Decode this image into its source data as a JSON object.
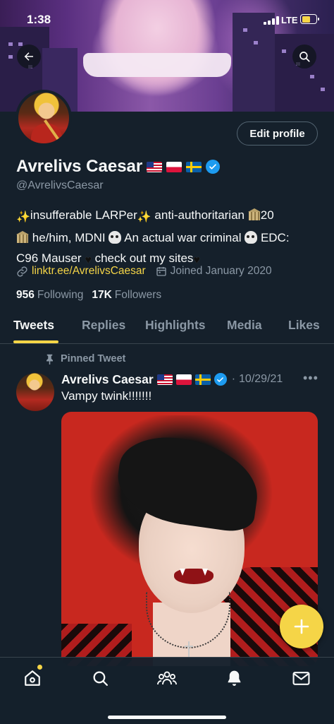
{
  "status_bar": {
    "time": "1:38",
    "network": "LTE"
  },
  "header": {
    "back_icon": "arrow-left-icon",
    "search_icon": "search-icon"
  },
  "profile": {
    "edit_button_label": "Edit profile",
    "display_name": "Avrelivs Caesar",
    "flags": [
      "us-flag",
      "poland-flag",
      "sweden-flag"
    ],
    "verified": true,
    "handle": "@AvrelivsCaesar",
    "bio": {
      "line1_text1": "insufferable LARPer",
      "line1_text2": "anti-authoritarian",
      "line1_text3": "20",
      "line2_text1": "he/him, MDNI",
      "line2_text2": "An actual war criminal",
      "line2_text3": "EDC:",
      "line3_text1": "C96 Mauser",
      "line3_text2": "check out my sites"
    },
    "link": "linktr.ee/AvrelivsCaesar",
    "joined": "Joined January 2020",
    "following_count": "956",
    "following_label": "Following",
    "followers_count": "17K",
    "followers_label": "Followers"
  },
  "tabs": [
    {
      "label": "Tweets",
      "active": true
    },
    {
      "label": "Replies",
      "active": false
    },
    {
      "label": "Highlights",
      "active": false
    },
    {
      "label": "Media",
      "active": false
    },
    {
      "label": "Likes",
      "active": false
    }
  ],
  "pinned_tweet": {
    "pinned_label": "Pinned Tweet",
    "author_name": "Avrelivs Caesar",
    "date": "10/29/21",
    "more_icon": "more-horizontal-icon",
    "text": "Vampy twink!!!!!!!",
    "media": "photo"
  },
  "fab": {
    "icon": "plus-icon"
  },
  "bottom_nav": {
    "items": [
      "home-icon",
      "search-icon",
      "communities-icon",
      "notifications-icon",
      "messages-icon"
    ],
    "home_has_dot": true
  },
  "colors": {
    "background": "#15202b",
    "accent": "#f5d547",
    "muted_text": "#8b98a5",
    "verified_blue": "#1d9bf0"
  }
}
